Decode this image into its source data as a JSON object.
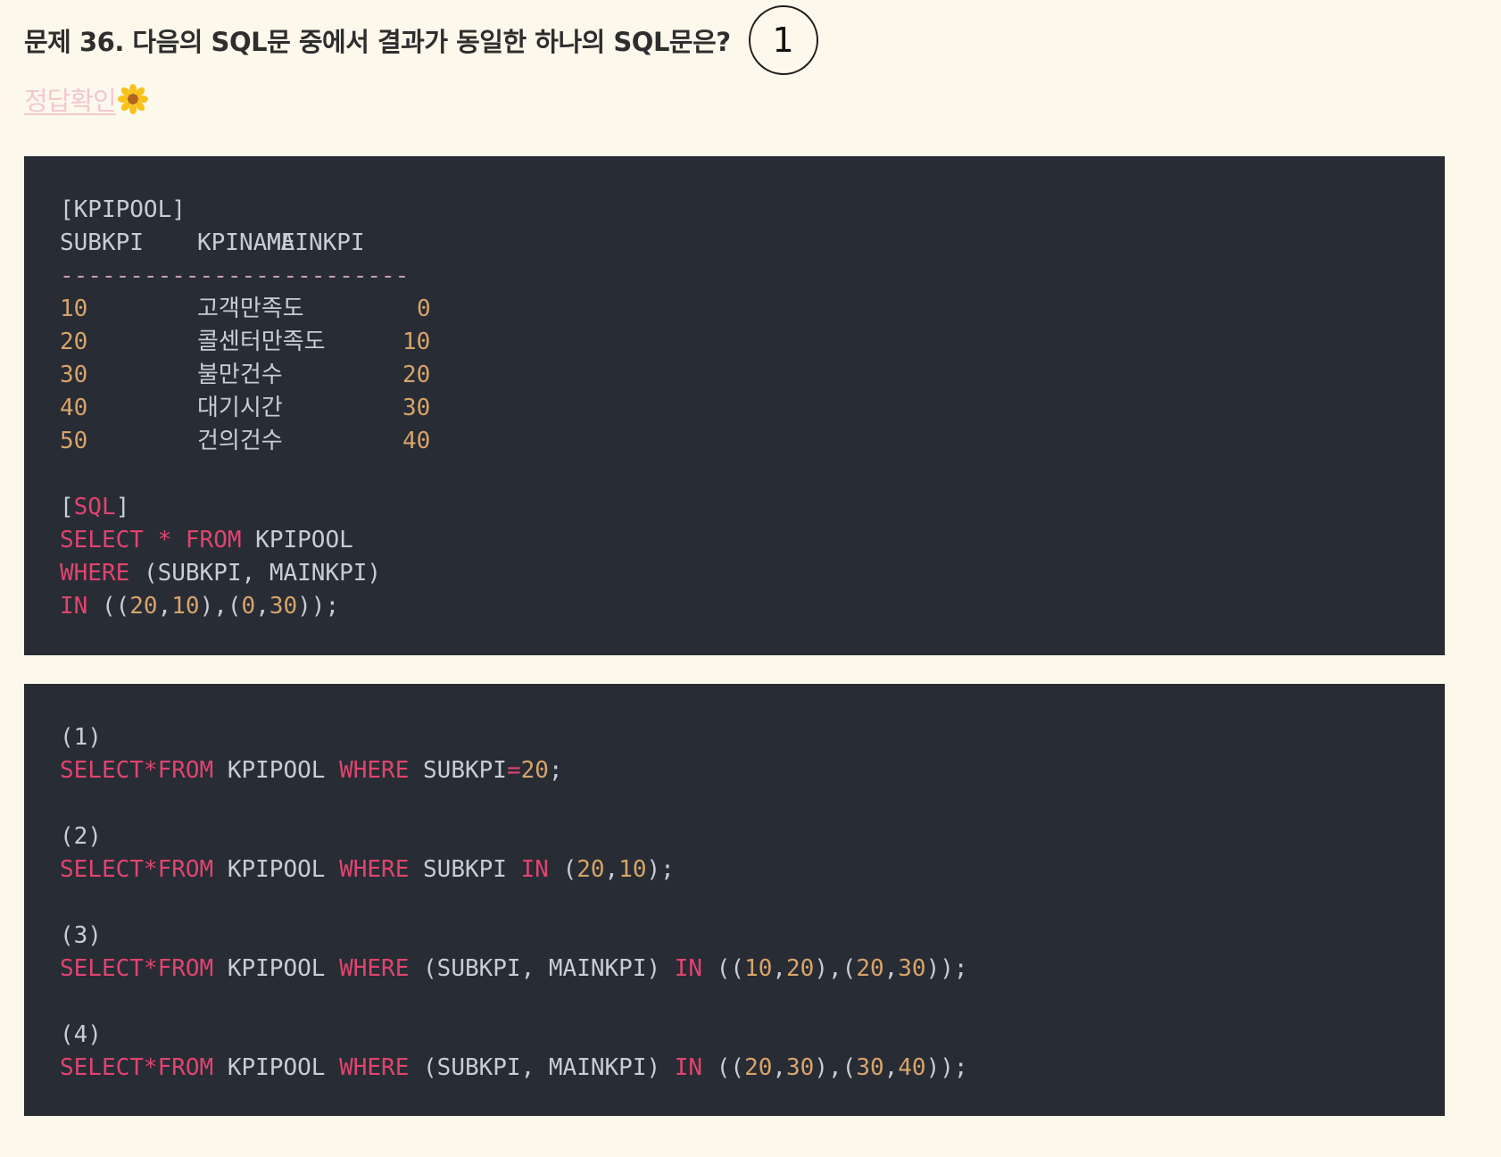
{
  "header": {
    "question": "문제 36. 다음의 SQL문 중에서 결과가 동일한 하나의 SQL문은?",
    "answer": "1"
  },
  "check": {
    "label": "정답확인",
    "icon": "flower-icon"
  },
  "table": {
    "name": "[KPIPOOL]",
    "columns": [
      "SUBKPI",
      "KPINAME",
      "MAINKPI"
    ],
    "separator": "-------------------------",
    "rows": [
      {
        "subkpi": "10",
        "kpiname": "고객만족도",
        "mainkpi": "0"
      },
      {
        "subkpi": "20",
        "kpiname": "콜센터만족도",
        "mainkpi": "10"
      },
      {
        "subkpi": "30",
        "kpiname": "불만건수",
        "mainkpi": "20"
      },
      {
        "subkpi": "40",
        "kpiname": "대기시간",
        "mainkpi": "30"
      },
      {
        "subkpi": "50",
        "kpiname": "건의건수",
        "mainkpi": "40"
      }
    ]
  },
  "sql": {
    "label_open": "[",
    "label": "SQL",
    "label_close": "]",
    "line1": {
      "select": "SELECT",
      "star": "*",
      "from": "FROM",
      "rest": "KPIPOOL"
    },
    "line2": {
      "where": "WHERE",
      "rest": "(SUBKPI, MAINKPI)"
    },
    "line3": {
      "in": "IN",
      "p1": "((",
      "n1": "20",
      "c1": ",",
      "n2": "10",
      "p2": "),(",
      "n3": "0",
      "c2": ",",
      "n4": "30",
      "p3": "));"
    }
  },
  "options": [
    {
      "num": "(1)",
      "select": "SELECT*FROM",
      "table": "KPIPOOL",
      "where": "WHERE",
      "cond": "SUBKPI",
      "op": "=",
      "v1": "20",
      "end": ";"
    },
    {
      "num": "(2)",
      "select": "SELECT*FROM",
      "table": "KPIPOOL",
      "where": "WHERE",
      "cond": "SUBKPI",
      "in": "IN",
      "p1": "(",
      "v1": "20",
      "c1": ",",
      "v2": "10",
      "end": ");"
    },
    {
      "num": "(3)",
      "select": "SELECT*FROM",
      "table": "KPIPOOL",
      "where": "WHERE",
      "cond": "(SUBKPI, MAINKPI)",
      "in": "IN",
      "p1": "((",
      "v1": "10",
      "c1": ",",
      "v2": "20",
      "p2": "),(",
      "v3": "20",
      "c2": ",",
      "v4": "30",
      "end": "));"
    },
    {
      "num": "(4)",
      "select": "SELECT*FROM",
      "table": "KPIPOOL",
      "where": "WHERE",
      "cond": "(SUBKPI, MAINKPI)",
      "in": "IN",
      "p1": "((",
      "v1": "20",
      "c1": ",",
      "v2": "30",
      "p2": "),(",
      "v3": "30",
      "c2": ",",
      "v4": "40",
      "end": "));"
    }
  ]
}
